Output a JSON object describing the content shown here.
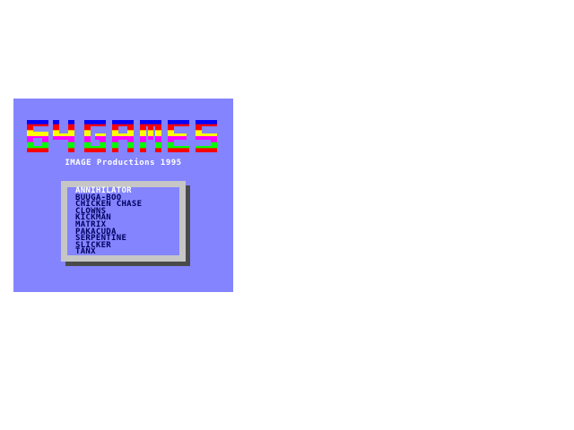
{
  "title": "64 GAMES",
  "subtitle": "IMAGE Productions 1995",
  "stripe_colors": [
    "#0000ff",
    "#ff0000",
    "#ffff00",
    "#ff00ff",
    "#00ff00",
    "#ff0000"
  ],
  "background_color": "#8484ff",
  "menu": {
    "selected_index": 0,
    "items": [
      "ANNIHILATOR",
      "BUUGA-BOO",
      "CHICKEN CHASE",
      "CLOWNS",
      "KICKMAN",
      "MATRIX",
      "PAKACUDA",
      "SERPENTINE",
      "SLICKER",
      "TANX"
    ]
  }
}
